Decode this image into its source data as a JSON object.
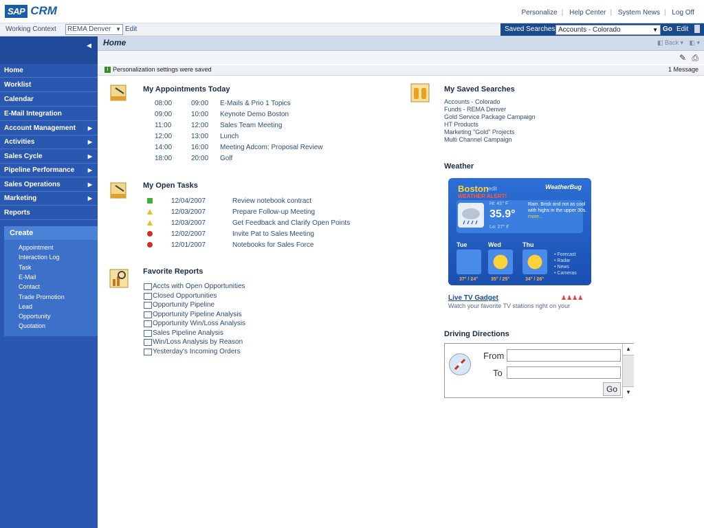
{
  "header": {
    "logo_sap": "SAP",
    "logo_crm": "CRM",
    "links": [
      "Personalize",
      "Help Center",
      "System News",
      "Log Off"
    ]
  },
  "context": {
    "label": "Working Context",
    "value": "REMA Denver",
    "edit": "Edit"
  },
  "saved_searches": {
    "label": "Saved Searches",
    "value": "Accounts - Colorado",
    "go": "Go",
    "edit": "Edit"
  },
  "nav": {
    "items": [
      {
        "label": "Home",
        "arrow": false
      },
      {
        "label": "Worklist",
        "arrow": false
      },
      {
        "label": "Calendar",
        "arrow": false
      },
      {
        "label": "E-Mail Integration",
        "arrow": false
      },
      {
        "label": "Account Management",
        "arrow": true
      },
      {
        "label": "Activities",
        "arrow": true
      },
      {
        "label": "Sales Cycle",
        "arrow": true
      },
      {
        "label": "Pipeline Performance",
        "arrow": true
      },
      {
        "label": "Sales Operations",
        "arrow": true
      },
      {
        "label": "Marketing",
        "arrow": true
      },
      {
        "label": "Reports",
        "arrow": false
      }
    ],
    "create_title": "Create",
    "create_items": [
      "Appointment",
      "Interaction Log",
      "Task",
      "E-Mail",
      "Contact",
      "Trade Promotion",
      "Lead",
      "Opportunity",
      "Quotation"
    ]
  },
  "page": {
    "title": "Home",
    "back": "Back",
    "message": "Personalization settings were saved",
    "message_count": "1 Message"
  },
  "appointments": {
    "title": "My Appointments Today",
    "rows": [
      {
        "start": "08:00",
        "end": "09:00",
        "subject": "E-Mails & Prio 1 Topics"
      },
      {
        "start": "09:00",
        "end": "10:00",
        "subject": "Keynote Demo Boston"
      },
      {
        "start": "11:00",
        "end": "12:00",
        "subject": "Sales Team Meeting"
      },
      {
        "start": "12:00",
        "end": "13:00",
        "subject": "Lunch"
      },
      {
        "start": "14:00",
        "end": "16:00",
        "subject": "Meeting Adcom: Proposal Review"
      },
      {
        "start": "18:00",
        "end": "20:00",
        "subject": "Golf"
      }
    ]
  },
  "tasks": {
    "title": "My Open Tasks",
    "rows": [
      {
        "status": "green",
        "date": "12/04/2007",
        "subject": "Review notebook contract"
      },
      {
        "status": "yellow",
        "date": "12/03/2007",
        "subject": "Prepare Follow-up Meeting"
      },
      {
        "status": "yellow",
        "date": "12/03/2007",
        "subject": "Get Feedback and Clarify Open Points"
      },
      {
        "status": "red",
        "date": "12/02/2007",
        "subject": "Invite Pat to Sales Meeting"
      },
      {
        "status": "red",
        "date": "12/01/2007",
        "subject": "Notebooks for Sales Force"
      }
    ]
  },
  "reports": {
    "title": "Favorite Reports",
    "items": [
      "Accts with Open Opportunities",
      "Closed Opportunities",
      "Opportunity Pipeline",
      "Opportunity Pipeline Analysis",
      "Opportunity Win/Loss Analysis",
      "Sales Pipeline Analysis",
      "Win/Loss Analysis by Reason",
      "Yesterday's Incoming Orders"
    ]
  },
  "searches": {
    "title": "My Saved Searches",
    "items": [
      "Accounts - Colorado",
      "Funds - REMA Denver",
      "Gold Service Package Campaign",
      "HT Products",
      "Marketing \"Gold\" Projects",
      "Multi Channel Campaign"
    ]
  },
  "weather": {
    "title": "Weather",
    "city": "Boston",
    "edit": "edit",
    "alert": "WEATHER ALERT!",
    "brand": "WeatherBug",
    "hi": "Hi: 41° F",
    "temp": "35.9°",
    "lo": "Lo: 27° F",
    "desc": "Rain. Brisk and not as cool with highs in the upper 30s.",
    "more": "more...",
    "days": [
      {
        "name": "Tue",
        "temps": "37° / 24°"
      },
      {
        "name": "Wed",
        "temps": "35° / 25°"
      },
      {
        "name": "Thu",
        "temps": "34° / 26°"
      }
    ],
    "links": [
      "• Forecast",
      "• Radar",
      "• News",
      "• Cameras"
    ],
    "tv_title": "Live TV Gadget",
    "tv_desc": "Watch your favorite TV stations right on your"
  },
  "driving": {
    "title": "Driving Directions",
    "from": "From",
    "to": "To",
    "go": "Go"
  },
  "colors": {
    "brand": "#1b5dab",
    "sidebar": "#2a57b0",
    "status_green": "#3fae3a",
    "status_yellow": "#e8c020",
    "status_red": "#d03020"
  }
}
